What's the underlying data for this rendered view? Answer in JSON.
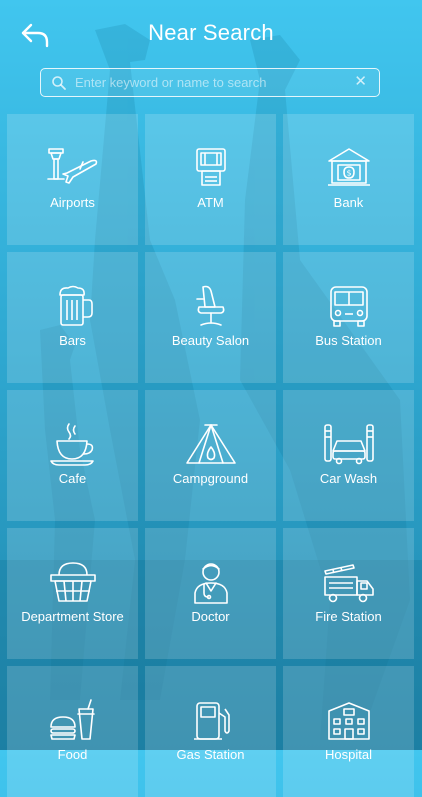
{
  "header": {
    "title": "Near Search"
  },
  "search": {
    "placeholder": "Enter keyword or name to search",
    "value": ""
  },
  "categories": [
    {
      "label": "Airports",
      "icon": "airport-icon"
    },
    {
      "label": "ATM",
      "icon": "atm-icon"
    },
    {
      "label": "Bank",
      "icon": "bank-icon"
    },
    {
      "label": "Bars",
      "icon": "beer-mug-icon"
    },
    {
      "label": "Beauty Salon",
      "icon": "salon-chair-icon"
    },
    {
      "label": "Bus Station",
      "icon": "bus-icon"
    },
    {
      "label": "Cafe",
      "icon": "coffee-cup-icon"
    },
    {
      "label": "Campground",
      "icon": "tent-icon"
    },
    {
      "label": "Car Wash",
      "icon": "car-wash-icon"
    },
    {
      "label": "Department Store",
      "icon": "shopping-basket-icon"
    },
    {
      "label": "Doctor",
      "icon": "doctor-icon"
    },
    {
      "label": "Fire Station",
      "icon": "fire-truck-icon"
    },
    {
      "label": "Food",
      "icon": "fast-food-icon"
    },
    {
      "label": "Gas Station",
      "icon": "fuel-pump-icon"
    },
    {
      "label": "Hospital",
      "icon": "hospital-icon"
    }
  ]
}
